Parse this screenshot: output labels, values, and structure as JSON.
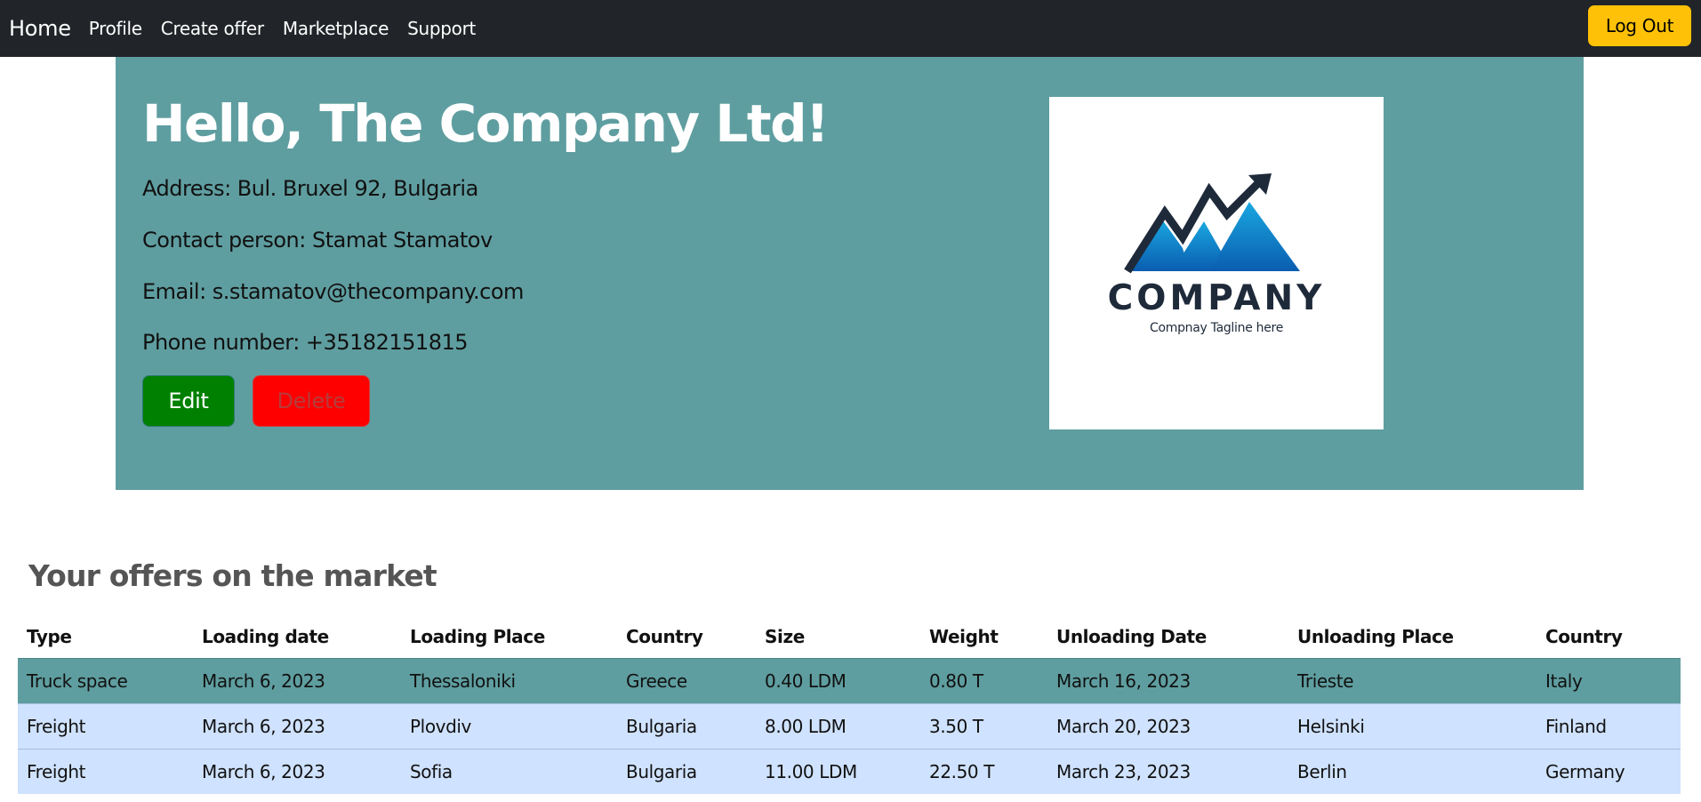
{
  "navbar": {
    "brand": "Home",
    "links": [
      "Profile",
      "Create offer",
      "Marketplace",
      "Support"
    ],
    "logout_label": "Log Out"
  },
  "profile": {
    "greeting": "Hello, The Company Ltd!",
    "address": "Address: Bul. Bruxel 92, Bulgaria",
    "contact": "Contact person: Stamat Stamatov",
    "email": "Email: s.stamatov@thecompany.com",
    "phone": "Phone number: +35182151815",
    "edit_label": "Edit",
    "delete_label": "Delete"
  },
  "logo": {
    "word": "COMPANY",
    "tagline": "Compnay Tagline here"
  },
  "offers": {
    "title": "Your offers on the market",
    "headers": [
      "Type",
      "Loading date",
      "Loading Place",
      "Country",
      "Size",
      "Weight",
      "Unloading Date",
      "Unloading Place",
      "Country"
    ],
    "rows": [
      [
        "Truck space",
        "March 6, 2023",
        "Thessaloniki",
        "Greece",
        "0.40 LDM",
        "0.80 T",
        "March 16, 2023",
        "Trieste",
        "Italy"
      ],
      [
        "Freight",
        "March 6, 2023",
        "Plovdiv",
        "Bulgaria",
        "8.00 LDM",
        "3.50 T",
        "March 20, 2023",
        "Helsinki",
        "Finland"
      ],
      [
        "Freight",
        "March 6, 2023",
        "Sofia",
        "Bulgaria",
        "11.00 LDM",
        "22.50 T",
        "March 23, 2023",
        "Berlin",
        "Germany"
      ]
    ]
  },
  "colors": {
    "navbar_bg": "#212529",
    "hero_bg": "#5f9ea0",
    "logout_bg": "#ffc107",
    "edit_bg": "#008000",
    "delete_bg": "#ff0000",
    "row_highlight": "#5f9ea0",
    "row_normal": "#cfe2ff"
  }
}
